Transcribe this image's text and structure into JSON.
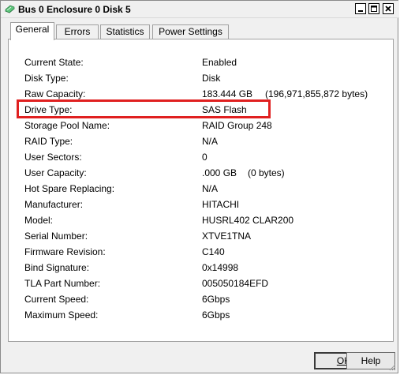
{
  "window": {
    "title": "Bus 0 Enclosure 0 Disk 5"
  },
  "title_buttons": {
    "minimize": "minimize",
    "maximize": "maximize",
    "close": "close"
  },
  "tabs": [
    {
      "label": "General",
      "active": true
    },
    {
      "label": "Errors",
      "active": false
    },
    {
      "label": "Statistics",
      "active": false
    },
    {
      "label": "Power Settings",
      "active": false
    }
  ],
  "properties": [
    {
      "label": "Current State:",
      "value": "Enabled",
      "extra": ""
    },
    {
      "label": "Disk Type:",
      "value": "Disk",
      "extra": ""
    },
    {
      "label": "Raw Capacity:",
      "value": "183.444 GB",
      "extra": "(196,971,855,872 bytes)"
    },
    {
      "label": "Drive Type:",
      "value": "SAS Flash",
      "extra": "",
      "highlighted": true
    },
    {
      "label": "Storage Pool Name:",
      "value": "RAID Group 248",
      "extra": ""
    },
    {
      "label": "RAID Type:",
      "value": "N/A",
      "extra": ""
    },
    {
      "label": "User Sectors:",
      "value": "0",
      "extra": ""
    },
    {
      "label": "User Capacity:",
      "value": ".000 GB",
      "extra": "(0 bytes)"
    },
    {
      "label": "Hot Spare Replacing:",
      "value": "N/A",
      "extra": ""
    },
    {
      "label": "Manufacturer:",
      "value": "HITACHI",
      "extra": ""
    },
    {
      "label": "Model:",
      "value": "HUSRL402 CLAR200",
      "extra": ""
    },
    {
      "label": "Serial Number:",
      "value": "XTVE1TNA",
      "extra": ""
    },
    {
      "label": "Firmware Revision:",
      "value": "C140",
      "extra": ""
    },
    {
      "label": "Bind Signature:",
      "value": "0x14998",
      "extra": ""
    },
    {
      "label": "TLA Part Number:",
      "value": "005050184EFD",
      "extra": ""
    },
    {
      "label": "Current Speed:",
      "value": "6Gbps",
      "extra": ""
    },
    {
      "label": "Maximum Speed:",
      "value": "6Gbps",
      "extra": ""
    }
  ],
  "buttons": {
    "ok": "OK",
    "help": "Help"
  },
  "colors": {
    "highlight": "#e02020",
    "app_icon": "#2e8b57"
  }
}
